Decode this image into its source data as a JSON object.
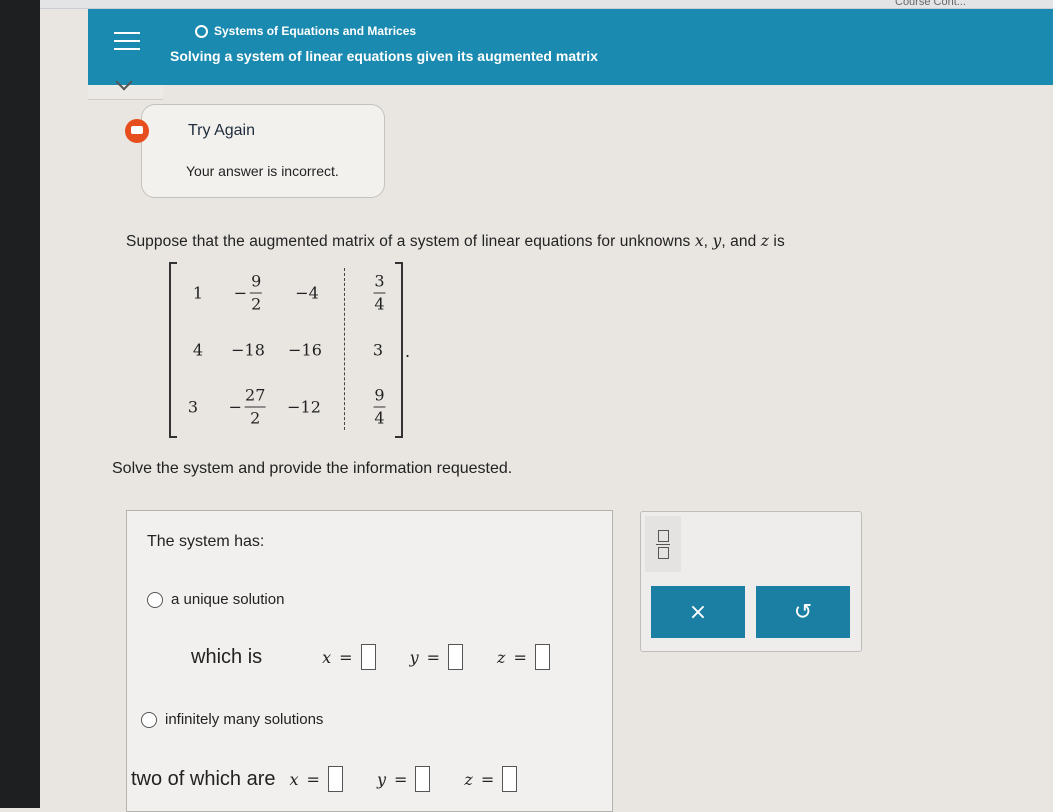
{
  "topbar": {
    "course_label": "Course Cont..."
  },
  "header": {
    "topic": "Systems of Equations and Matrices",
    "title": "Solving a system of linear equations given its augmented matrix"
  },
  "feedback": {
    "title": "Try Again",
    "message": "Your answer is incorrect."
  },
  "question": {
    "text_pre": "Suppose that the augmented matrix of a system of linear equations for unknowns ",
    "var_x": "x",
    "comma1": ", ",
    "var_y": "y",
    "comma2": ", and ",
    "var_z": "z",
    "text_post": " is",
    "matrix": {
      "r1": {
        "c1": "1",
        "c2_sign": "−",
        "c2_num": "9",
        "c2_den": "2",
        "c3": "−4",
        "c4_num": "3",
        "c4_den": "4"
      },
      "r2": {
        "c1": "4",
        "c2": "−18",
        "c3": "−16",
        "c4": "3"
      },
      "r3": {
        "c1": "3",
        "c2_sign": "−",
        "c2_num": "27",
        "c2_den": "2",
        "c3": "−12",
        "c4_num": "9",
        "c4_den": "4"
      },
      "period": "."
    },
    "instruction": "Solve the system and provide the information requested."
  },
  "answer": {
    "prompt": "The system has:",
    "option_unique": "a unique solution",
    "which_is": "which is",
    "option_infinite": "infinitely many solutions",
    "two_of_which": "two of which are",
    "vars": {
      "x": "x",
      "y": "y",
      "z": "z",
      "eq": "="
    }
  },
  "tools": {
    "clear_symbol": "×",
    "undo_symbol": "↺"
  },
  "colors": {
    "header": "#1b8ab0",
    "button": "#1b7ea3",
    "feedback_icon": "#e74e1e"
  }
}
